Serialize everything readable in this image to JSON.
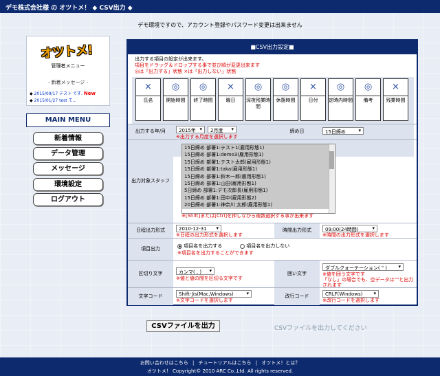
{
  "header": {
    "title": "デモ株式会社様 の オツトメ！ ◆ CSV出力 ◆"
  },
  "notice": "デモ環境ですので、アカウント登録やパスワード変更は出来ません",
  "sidebar": {
    "logo_text": "オツトメ!",
    "logo_sub": "管理者メニュー",
    "news_title": "- 新着メッセージ -",
    "news": [
      {
        "text": "2015/09/17 テスト です.",
        "badge": "New"
      },
      {
        "text": "2015/01/27 test て...",
        "badge": ""
      }
    ],
    "menu_title": "MAIN MENU",
    "menu_items": [
      "新着情報",
      "データ管理",
      "メッセージ",
      "環境設定",
      "ログアウト"
    ]
  },
  "panel": {
    "title": "■CSV出力設定■",
    "intro": "出力する項目の設定が出来ます。",
    "intro_red1": "項目をドラッグ＆ドロップする事で並び順が変更出来ます",
    "intro_red2": "◎は「出力する」状態 ×は「出力しない」状態",
    "columns": [
      {
        "sym": "×",
        "label": "氏名"
      },
      {
        "sym": "◎",
        "label": "開始時間"
      },
      {
        "sym": "◎",
        "label": "終了時間"
      },
      {
        "sym": "×",
        "label": "曜日"
      },
      {
        "sym": "◎",
        "label": "深夜残業時間"
      },
      {
        "sym": "◎",
        "label": "休憩時間"
      },
      {
        "sym": "×",
        "label": "日付"
      },
      {
        "sym": "◎",
        "label": "定時内時間"
      },
      {
        "sym": "◎",
        "label": "備考"
      },
      {
        "sym": "×",
        "label": "残業時間"
      }
    ],
    "year_month": {
      "label": "出力する年/月",
      "year": "2015年",
      "month": "2月度",
      "hint": "※出力する月度を選択します"
    },
    "closing": {
      "label": "締め日",
      "value": "15日締め"
    },
    "staff": {
      "label": "出力対象スタッフ",
      "options": [
        "15日締め 部署1:テスト1(雇用形態1)",
        "15日締め 部署1:demo3(雇用形態1)",
        "15日締め 部署1:テスト太郎(雇用形態1)",
        "15日締め 部署1:taka(雇用形態1)",
        "15日締め 部署1:鈴木一郎(雇用形態1)",
        "15日締め 部署1:山田(雇用形態1)",
        "5日締め 部署1:デモ次郎長(雇用形態1)",
        "15日締め 部署1:田中(雇用形態2)",
        "20日締め 部署1:神奈川 太郎(雇用形態1)"
      ],
      "hint": "※[Shift]または[Ctrl]を押しながら複数選択する事が出来ます"
    },
    "date_format": {
      "label": "日程出力形式",
      "value": "2010-12-31",
      "hint": "※日程の出力形式を選択します"
    },
    "time_format": {
      "label": "時間出力形式",
      "value": "09:00(24時間)",
      "hint": "※時間の出力形式を選択します"
    },
    "item_output": {
      "label": "項目出力",
      "opt_on": "項目名を出力する",
      "opt_off": "項目名を出力しない",
      "hint": "※項目名を出力することができます"
    },
    "delimiter": {
      "label": "区切り文字",
      "value": "カンマ( , )",
      "hint": "※値と値の間を区切る文字です"
    },
    "enclosure": {
      "label": "囲い文字",
      "value": "ダブルクォーテーション( \" )",
      "hint1": "※値を囲う文字です",
      "hint2": "「なし」の場合でも、空データは\"\"と出力されます"
    },
    "charset": {
      "label": "文字コード",
      "value": "Shift-Jis(Mac,Windows)",
      "hint": "※文字コードを選択します"
    },
    "newline": {
      "label": "改行コード",
      "value": "CRLF(Windows)",
      "hint": "※改行コードを選択します"
    }
  },
  "output_button": "CSVファイルを出力",
  "output_hint": "CSVファイルを出力してください",
  "footer": {
    "links": [
      "お問い合わせはこちら",
      "|",
      "チュートリアルはこちら",
      "|",
      "オツトメ！とは？"
    ],
    "copyright": "オツトメ！ Copyright© 2010 ARC Co.,Ltd. All rights reserved."
  }
}
